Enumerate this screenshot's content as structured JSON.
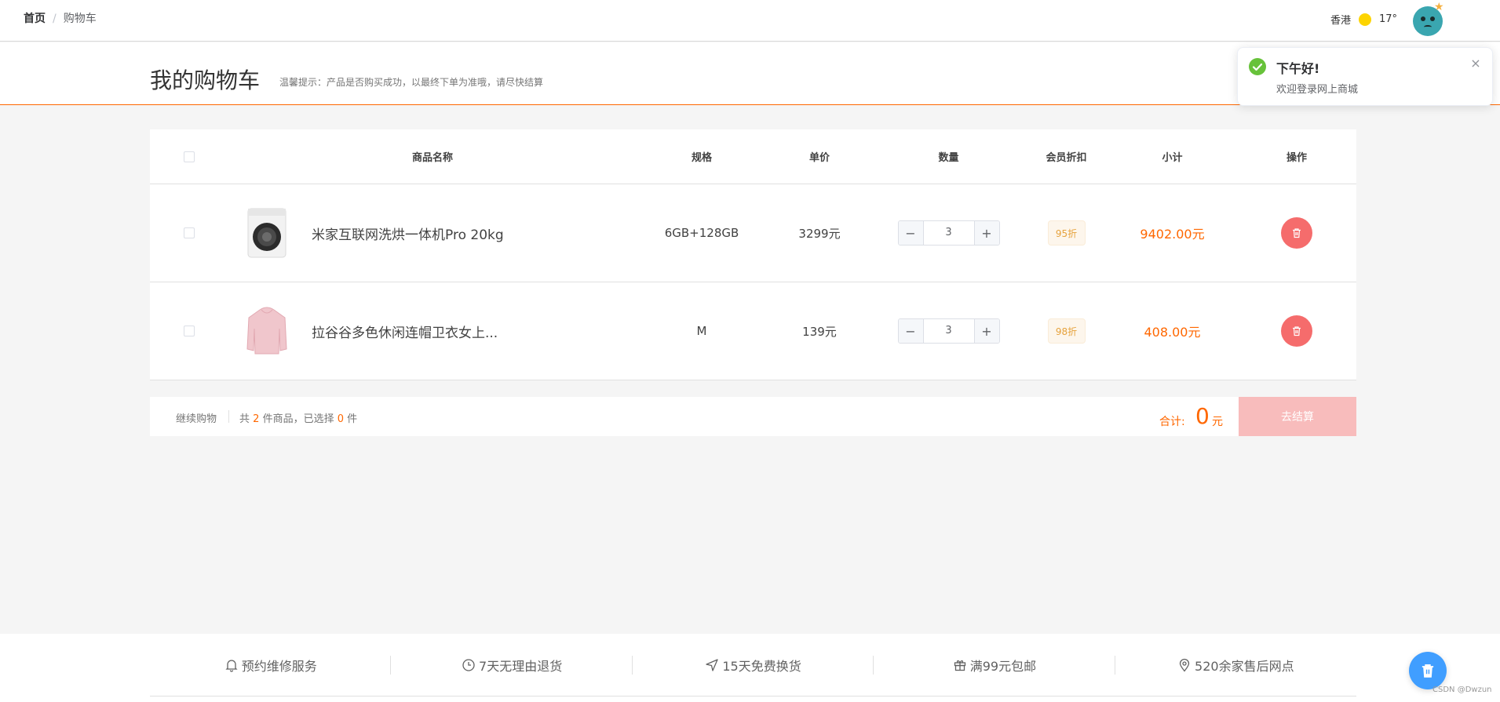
{
  "breadcrumb": {
    "home": "首页",
    "separator": "/",
    "current": "购物车"
  },
  "weather": {
    "city": "香港",
    "temperature": "17°"
  },
  "header": {
    "title": "我的购物车",
    "tip": "温馨提示：产品是否购买成功，以最终下单为准哦，请尽快结算"
  },
  "notification": {
    "title": "下午好!",
    "message": "欢迎登录网上商城",
    "close_icon": "×"
  },
  "table": {
    "columns": [
      "商品名称",
      "规格",
      "单价",
      "数量",
      "会员折扣",
      "小计",
      "操作"
    ],
    "rows": [
      {
        "name": "米家互联网洗烘一体机Pro 20kg",
        "spec": "6GB+128GB",
        "price": "3299元",
        "qty": "3",
        "discount": "95折",
        "subtotal": "9402.00元",
        "image": "washing-machine"
      },
      {
        "name": "拉谷谷多色休闲连帽卫衣女上...",
        "spec": "M",
        "price": "139元",
        "qty": "3",
        "discount": "98折",
        "subtotal": "408.00元",
        "image": "pink-hoodie"
      }
    ]
  },
  "cart_bar": {
    "continue": "继续购物",
    "count_prefix": "共",
    "count_total": "2",
    "count_mid": "件商品，已选择",
    "count_selected": "0",
    "count_suffix": "件",
    "total_label": "合计:",
    "total_value": "0",
    "total_unit": "元",
    "checkout": "去结算"
  },
  "services": [
    {
      "label": "预约维修服务",
      "icon": "bell-icon"
    },
    {
      "label": "7天无理由退货",
      "icon": "clock-icon"
    },
    {
      "label": "15天免费换货",
      "icon": "send-icon"
    },
    {
      "label": "满99元包邮",
      "icon": "gift-icon"
    },
    {
      "label": "520余家售后网点",
      "icon": "location-icon"
    }
  ],
  "watermark": "CSDN @Dwzun",
  "colors": {
    "accent": "#ff6700",
    "danger": "#f56c6c",
    "success": "#67c23a",
    "primary": "#409eff",
    "checkout_disabled": "#f8bcbc"
  }
}
